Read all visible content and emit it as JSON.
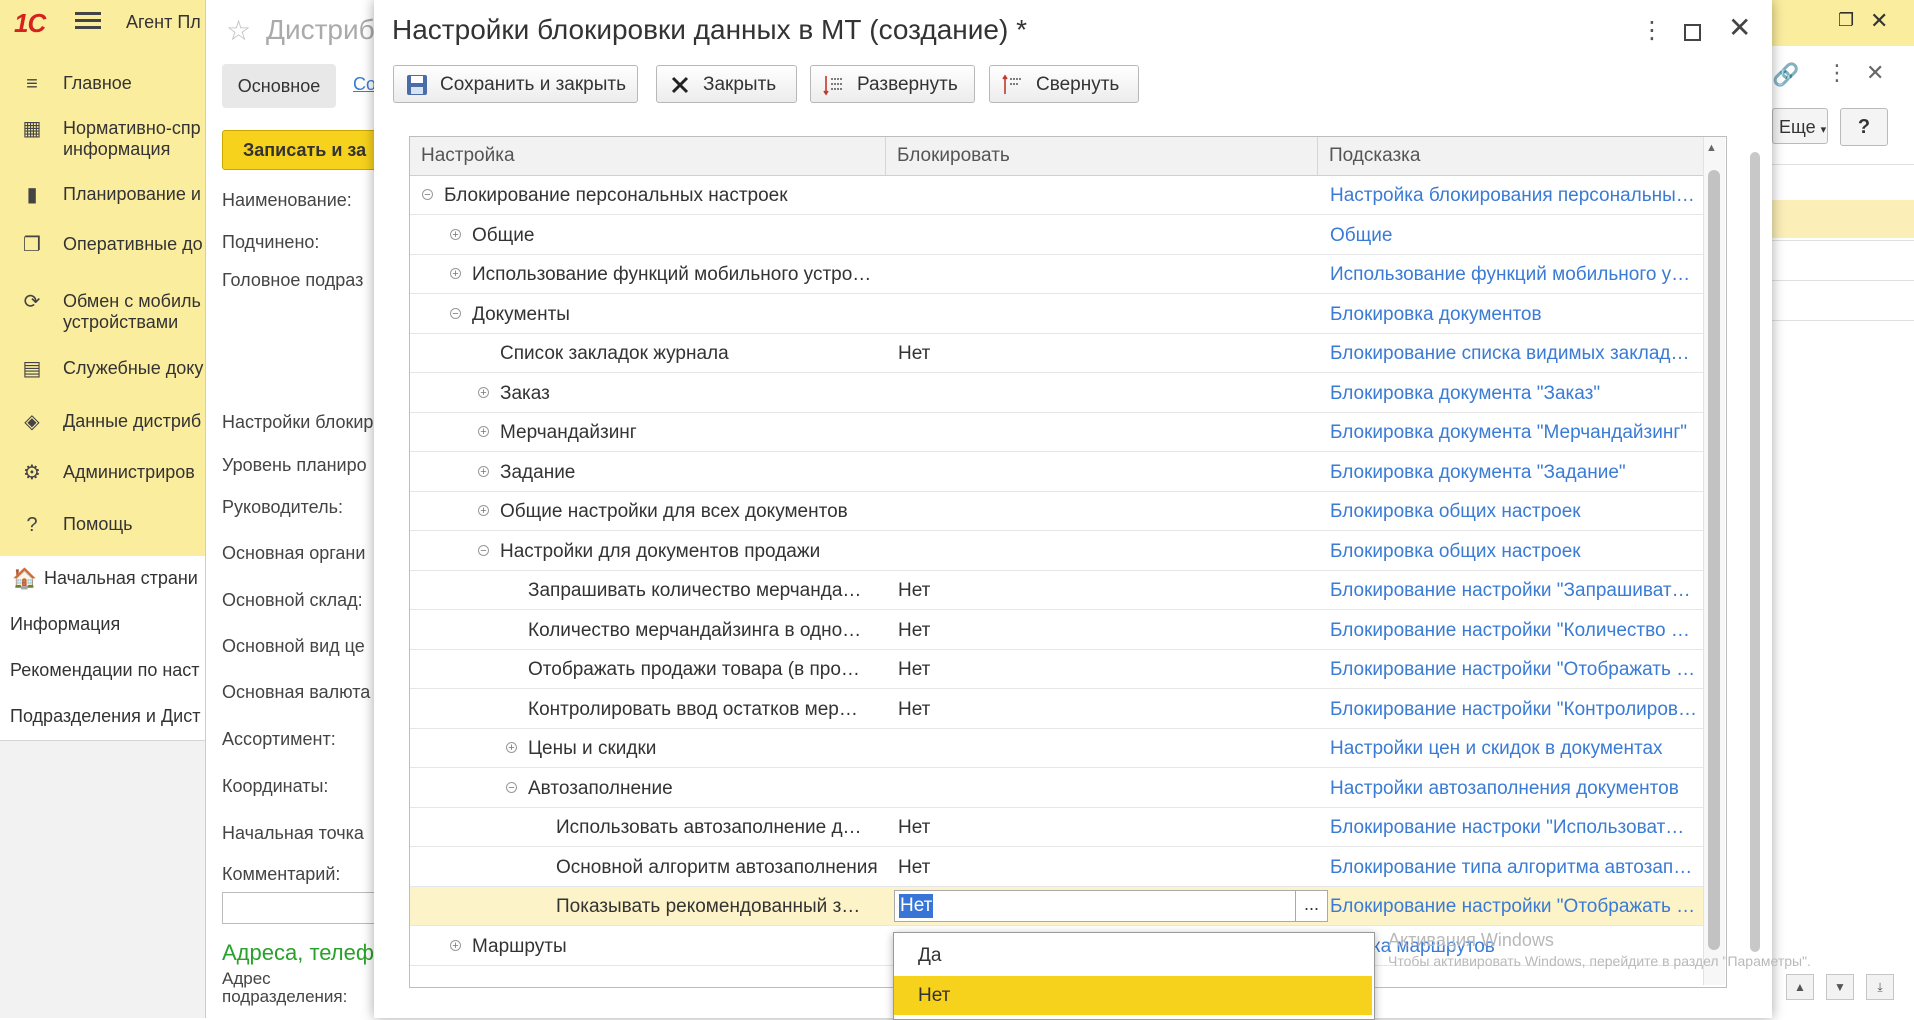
{
  "app": {
    "logo": "1С",
    "title": "Агент Пл"
  },
  "sidebar": {
    "items": [
      {
        "label": "Главное",
        "icon": "menu-lines-icon"
      },
      {
        "label": "Нормативно-спр\nинформация",
        "icon": "grid-book-icon"
      },
      {
        "label": "Планирование и",
        "icon": "bar-chart-icon"
      },
      {
        "label": "Оперативные до",
        "icon": "documents-icon"
      },
      {
        "label": "Обмен с мобиль\nустройствами",
        "icon": "sync-arrows-icon"
      },
      {
        "label": "Служебные доку",
        "icon": "service-doc-icon"
      },
      {
        "label": "Данные дистриб",
        "icon": "distrib-data-icon"
      },
      {
        "label": "Администриров",
        "icon": "gear-icon"
      },
      {
        "label": "Помощь",
        "icon": "question-icon"
      }
    ]
  },
  "lower_nav": {
    "home_label": "Начальная страни",
    "items": [
      "Информация",
      "Рекомендации по наст",
      "Подразделения и Дист"
    ]
  },
  "bg_form": {
    "title": "Дистриб",
    "tab_main": "Основное",
    "tab_link": "Со",
    "save_button": "Записать и за",
    "fields": [
      "Наименование:",
      "Подчинено:",
      "Головное подраз",
      "Настройки блокир",
      "Уровень планиро",
      "Руководитель:",
      "Основная органи",
      "Основной склад:",
      "Основной вид це",
      "Основная валюта",
      "Ассортимент:",
      "Координаты:",
      "Начальная точка",
      "Комментарий:"
    ],
    "section": "Адреса, телеф",
    "address_label": "Адрес\nподразделения:"
  },
  "right_window": {
    "more_button": "Еще",
    "help_button": "?"
  },
  "dialog": {
    "title": "Настройки блокировки данных в МТ (создание) *",
    "toolbar": {
      "save_close": "Сохранить и закрыть",
      "close": "Закрыть",
      "expand": "Развернуть",
      "collapse": "Свернуть"
    },
    "table": {
      "columns": [
        "Настройка",
        "Блокировать",
        "Подсказка"
      ],
      "rows": [
        {
          "name": "Блокирование персональных настроек",
          "level": 0,
          "toggle": "minus",
          "block": "",
          "hint": "Настройка блокирования персональны…"
        },
        {
          "name": "Общие",
          "level": 1,
          "toggle": "plus",
          "block": "",
          "hint": "Общие"
        },
        {
          "name": "Использование функций мобильного устро…",
          "level": 1,
          "toggle": "plus",
          "block": "",
          "hint": "Использование функций мобильного у…"
        },
        {
          "name": "Документы",
          "level": 1,
          "toggle": "minus",
          "block": "",
          "hint": "Блокировка документов"
        },
        {
          "name": "Список закладок журнала",
          "level": 2,
          "toggle": "",
          "block": "Нет",
          "hint": "Блокирование списка видимых заклад…"
        },
        {
          "name": "Заказ",
          "level": 2,
          "toggle": "plus",
          "block": "",
          "hint": "Блокировка документа \"Заказ\""
        },
        {
          "name": "Мерчандайзинг",
          "level": 2,
          "toggle": "plus",
          "block": "",
          "hint": "Блокировка документа \"Мерчандайзинг\""
        },
        {
          "name": "Задание",
          "level": 2,
          "toggle": "plus",
          "block": "",
          "hint": "Блокировка документа \"Задание\""
        },
        {
          "name": "Общие настройки для всех документов",
          "level": 2,
          "toggle": "plus",
          "block": "",
          "hint": "Блокировка общих настроек"
        },
        {
          "name": "Настройки для документов продажи",
          "level": 2,
          "toggle": "minus",
          "block": "",
          "hint": "Блокировка общих настроек"
        },
        {
          "name": "Запрашивать количество мерчанда…",
          "level": 3,
          "toggle": "",
          "block": "Нет",
          "hint": "Блокирование настройки \"Запрашиват…"
        },
        {
          "name": "Количество мерчандайзинга в одно…",
          "level": 3,
          "toggle": "",
          "block": "Нет",
          "hint": "Блокирование настройки \"Количество …"
        },
        {
          "name": "Отображать продажи товара (в про…",
          "level": 3,
          "toggle": "",
          "block": "Нет",
          "hint": "Блокирование настройки \"Отображать …"
        },
        {
          "name": "Контролировать ввод остатков мер…",
          "level": 3,
          "toggle": "",
          "block": "Нет",
          "hint": "Блокирование настройки \"Контролиров…"
        },
        {
          "name": "Цены и скидки",
          "level": 3,
          "toggle": "plus",
          "block": "",
          "hint": "Настройки цен и скидок в документах"
        },
        {
          "name": "Автозаполнение",
          "level": 3,
          "toggle": "minus",
          "block": "",
          "hint": "Настройки автозаполнения документов"
        },
        {
          "name": "Использовать автозаполнение д…",
          "level": 4,
          "toggle": "",
          "block": "Нет",
          "hint": "Блокирование настроки \"Использоват…"
        },
        {
          "name": "Основной алгоритм автозаполнения",
          "level": 4,
          "toggle": "",
          "block": "Нет",
          "hint": "Блокирование типа алгоритма автозап…"
        },
        {
          "name": "Показывать рекомендованный з…",
          "level": 4,
          "toggle": "",
          "block": "Нет",
          "hint": "Блокирование настройки \"Отображать …",
          "selected": true
        },
        {
          "name": "Маршруты",
          "level": 1,
          "toggle": "plus",
          "block": "",
          "hint": "ировка маршрутов"
        }
      ]
    },
    "dropdown": {
      "options": [
        "Да",
        "Нет"
      ],
      "active_index": 1
    },
    "edit_dots": "..."
  },
  "watermark": {
    "line1": "Активация Windows",
    "line2": "Чтобы активировать Windows, перейдите в раздел \"Параметры\"."
  },
  "colors": {
    "panel_yellow": "#fbed9e",
    "accent_yellow": "#f7d21d",
    "link_blue": "#3a7bd5",
    "selected_row": "#fdf3c8",
    "section_green": "#2aa12a"
  }
}
